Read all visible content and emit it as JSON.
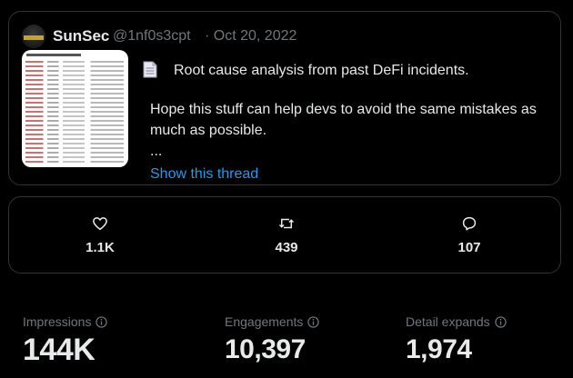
{
  "tweet": {
    "name": "SunSec",
    "handle": "@1nf0s3cpt",
    "date": "· Oct 20, 2022",
    "line1": "Root cause analysis from past DeFi incidents.",
    "line2": "Hope this stuff can help devs to avoid the same mistakes as",
    "line3": "much as possible.",
    "line4": "...",
    "show_thread": "Show this thread"
  },
  "actions": {
    "likes": "1.1K",
    "retweets": "439",
    "replies": "107"
  },
  "metrics": {
    "impressions_label": "Impressions",
    "impressions_value": "144K",
    "engagements_label": "Engagements",
    "engagements_value": "10,397",
    "detail_label": "Detail expands",
    "detail_value": "1,974"
  },
  "colors": {
    "background": "#000000",
    "border": "#2f3336",
    "link": "#1d9bf0",
    "muted": "#71767b",
    "text": "#e7e9ea"
  },
  "icons": [
    "avatar",
    "document-icon",
    "heart-icon",
    "retweet-icon",
    "reply-icon",
    "info-icon"
  ]
}
